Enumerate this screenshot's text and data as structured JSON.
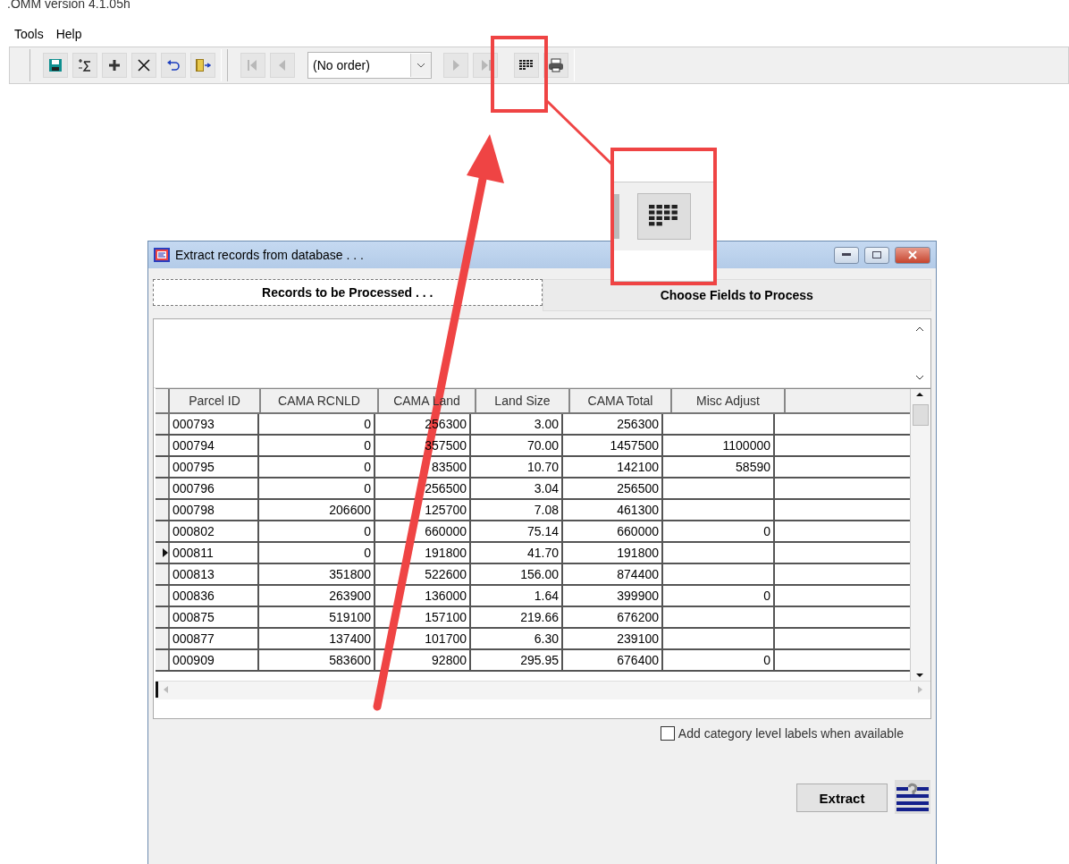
{
  "app_title": ".OMM version 4.1.05h",
  "menu": [
    "Tools",
    "Help"
  ],
  "toolbar": {
    "nav_buttons": [
      {
        "kind": "first",
        "disabled": true
      },
      {
        "kind": "prev",
        "disabled": true
      },
      {
        "kind": "next",
        "disabled": true
      },
      {
        "kind": "last",
        "disabled": true
      }
    ],
    "order_select": {
      "value": "(No order)"
    }
  },
  "dialog": {
    "title": "Extract records from database . . .",
    "tabs": [
      {
        "label": "Records to be Processed . . .",
        "selected": true
      },
      {
        "label": "Choose Fields to Process",
        "selected": false
      }
    ],
    "table": {
      "columns": [
        {
          "label": "Parcel ID"
        },
        {
          "label": "CAMA RCNLD"
        },
        {
          "label": "CAMA Land"
        },
        {
          "label": "Land Size"
        },
        {
          "label": "CAMA Total"
        },
        {
          "label": "Misc Adjust"
        }
      ],
      "rows": [
        {
          "current": false,
          "cells": [
            "000793",
            "0",
            "256300",
            "3.00",
            "256300",
            ""
          ]
        },
        {
          "current": false,
          "cells": [
            "000794",
            "0",
            "357500",
            "70.00",
            "1457500",
            "1100000"
          ]
        },
        {
          "current": false,
          "cells": [
            "000795",
            "0",
            "83500",
            "10.70",
            "142100",
            "58590"
          ]
        },
        {
          "current": false,
          "cells": [
            "000796",
            "0",
            "256500",
            "3.04",
            "256500",
            ""
          ]
        },
        {
          "current": false,
          "cells": [
            "000798",
            "206600",
            "125700",
            "7.08",
            "461300",
            ""
          ]
        },
        {
          "current": false,
          "cells": [
            "000802",
            "0",
            "660000",
            "75.14",
            "660000",
            "0"
          ]
        },
        {
          "current": true,
          "cells": [
            "000811",
            "0",
            "191800",
            "41.70",
            "191800",
            ""
          ]
        },
        {
          "current": false,
          "cells": [
            "000813",
            "351800",
            "522600",
            "156.00",
            "874400",
            ""
          ]
        },
        {
          "current": false,
          "cells": [
            "000836",
            "263900",
            "136000",
            "1.64",
            "399900",
            "0"
          ]
        },
        {
          "current": false,
          "cells": [
            "000875",
            "519100",
            "157100",
            "219.66",
            "676200",
            ""
          ]
        },
        {
          "current": false,
          "cells": [
            "000877",
            "137400",
            "101700",
            "6.30",
            "239100",
            ""
          ]
        },
        {
          "current": false,
          "cells": [
            "000909",
            "583600",
            "92800",
            "295.95",
            "676400",
            "0"
          ]
        }
      ]
    },
    "option": {
      "label": "Add category level labels when available",
      "checked": false
    },
    "extract_button": "Extract"
  }
}
